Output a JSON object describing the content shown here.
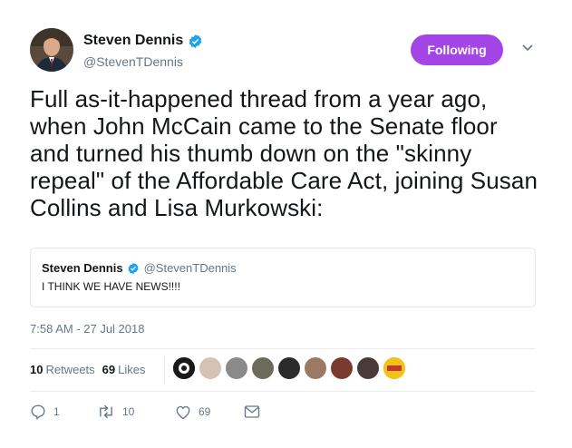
{
  "author": {
    "name": "Steven Dennis",
    "handle": "@StevenTDennis"
  },
  "follow_button": {
    "label": "Following"
  },
  "tweet": {
    "text": "Full as-it-happened thread from a year ago, when John McCain came to the Senate floor and turned his thumb down on the \"skinny repeal\" of the Affordable Care Act, joining Susan Collins and Lisa Murkowski:"
  },
  "quoted": {
    "name": "Steven Dennis",
    "handle": "@StevenTDennis",
    "text": "I THINK WE HAVE NEWS!!!!"
  },
  "timestamp": "7:58 AM - 27 Jul 2018",
  "stats": {
    "retweets_count": "10",
    "retweets_label": "Retweets",
    "likes_count": "69",
    "likes_label": "Likes"
  },
  "actions": {
    "reply_count": "1",
    "retweet_count": "10",
    "like_count": "69"
  },
  "colors": {
    "follow_button": "#a244e6",
    "verified": "#1da1f2",
    "muted": "#657786"
  },
  "icons": [
    "verified-badge-icon",
    "chevron-down-icon",
    "reply-icon",
    "retweet-icon",
    "like-icon",
    "message-icon"
  ]
}
